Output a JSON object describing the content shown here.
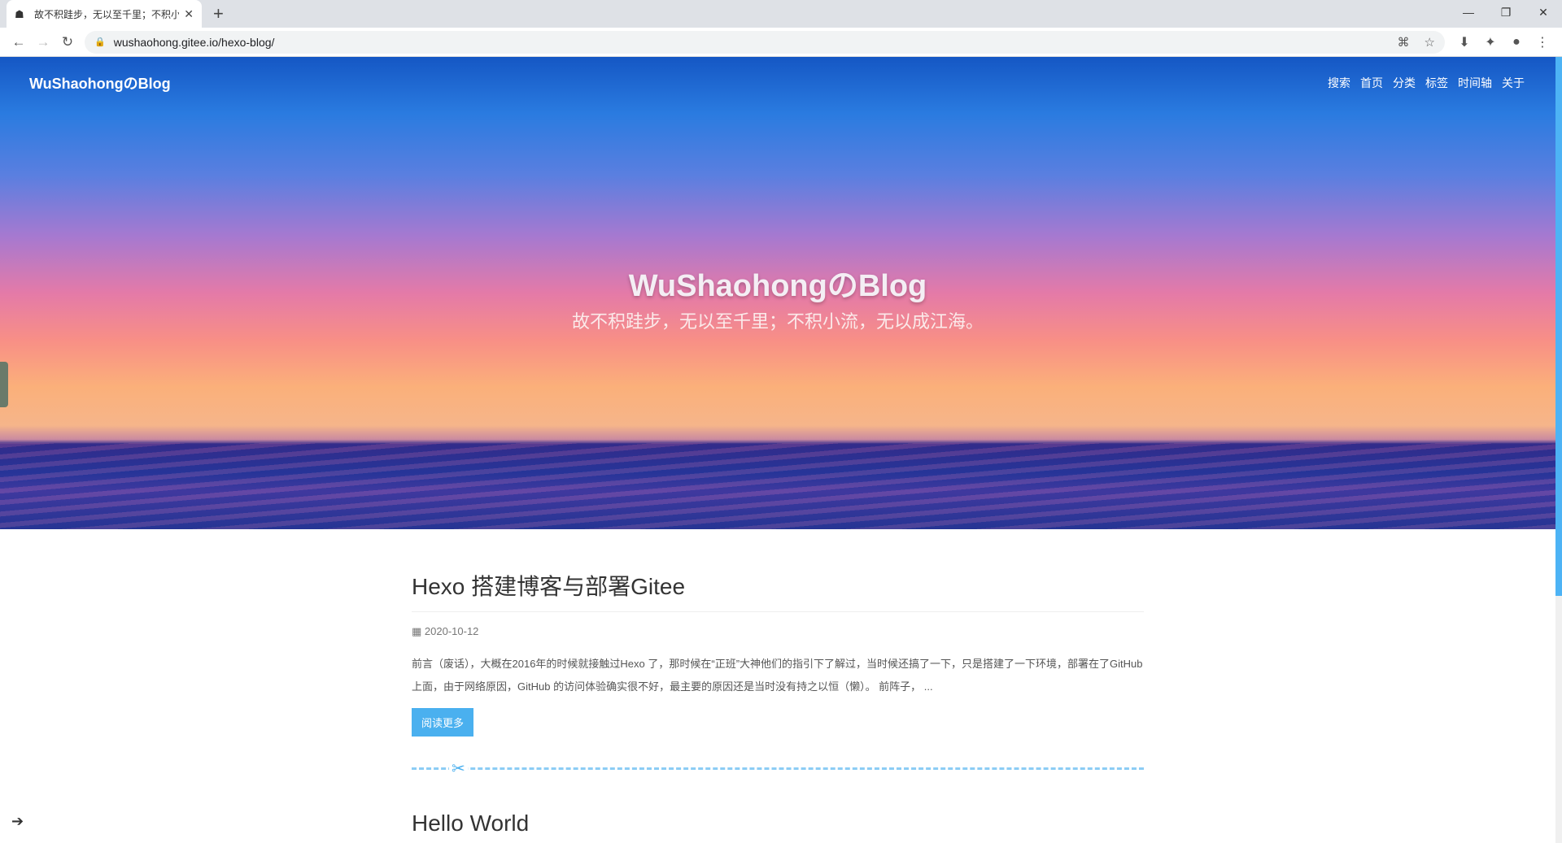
{
  "browser": {
    "tab_title": "故不积跬步，无以至千里；不积小流，无以成江海。",
    "url": "wushaohong.gitee.io/hexo-blog/"
  },
  "site": {
    "brand": "WuShaohongのBlog",
    "nav": [
      "搜索",
      "首页",
      "分类",
      "标签",
      "时间轴",
      "关于"
    ],
    "hero_title": "WuShaohongのBlog",
    "hero_subtitle": "故不积跬步，无以至千里；不积小流，无以成江海。"
  },
  "posts": [
    {
      "title": "Hexo 搭建博客与部署Gitee",
      "date": "2020-10-12",
      "excerpt": "前言（废话），大概在2016年的时候就接触过Hexo 了，那时候在“正班”大神他们的指引下了解过，当时候还搞了一下，只是搭建了一下环境，部署在了GitHub 上面，由于网络原因，GitHub 的访问体验确实很不好，最主要的原因还是当时没有持之以恒（懒）。 前阵子， ...",
      "read_more": "阅读更多"
    },
    {
      "title": "Hello World"
    }
  ]
}
